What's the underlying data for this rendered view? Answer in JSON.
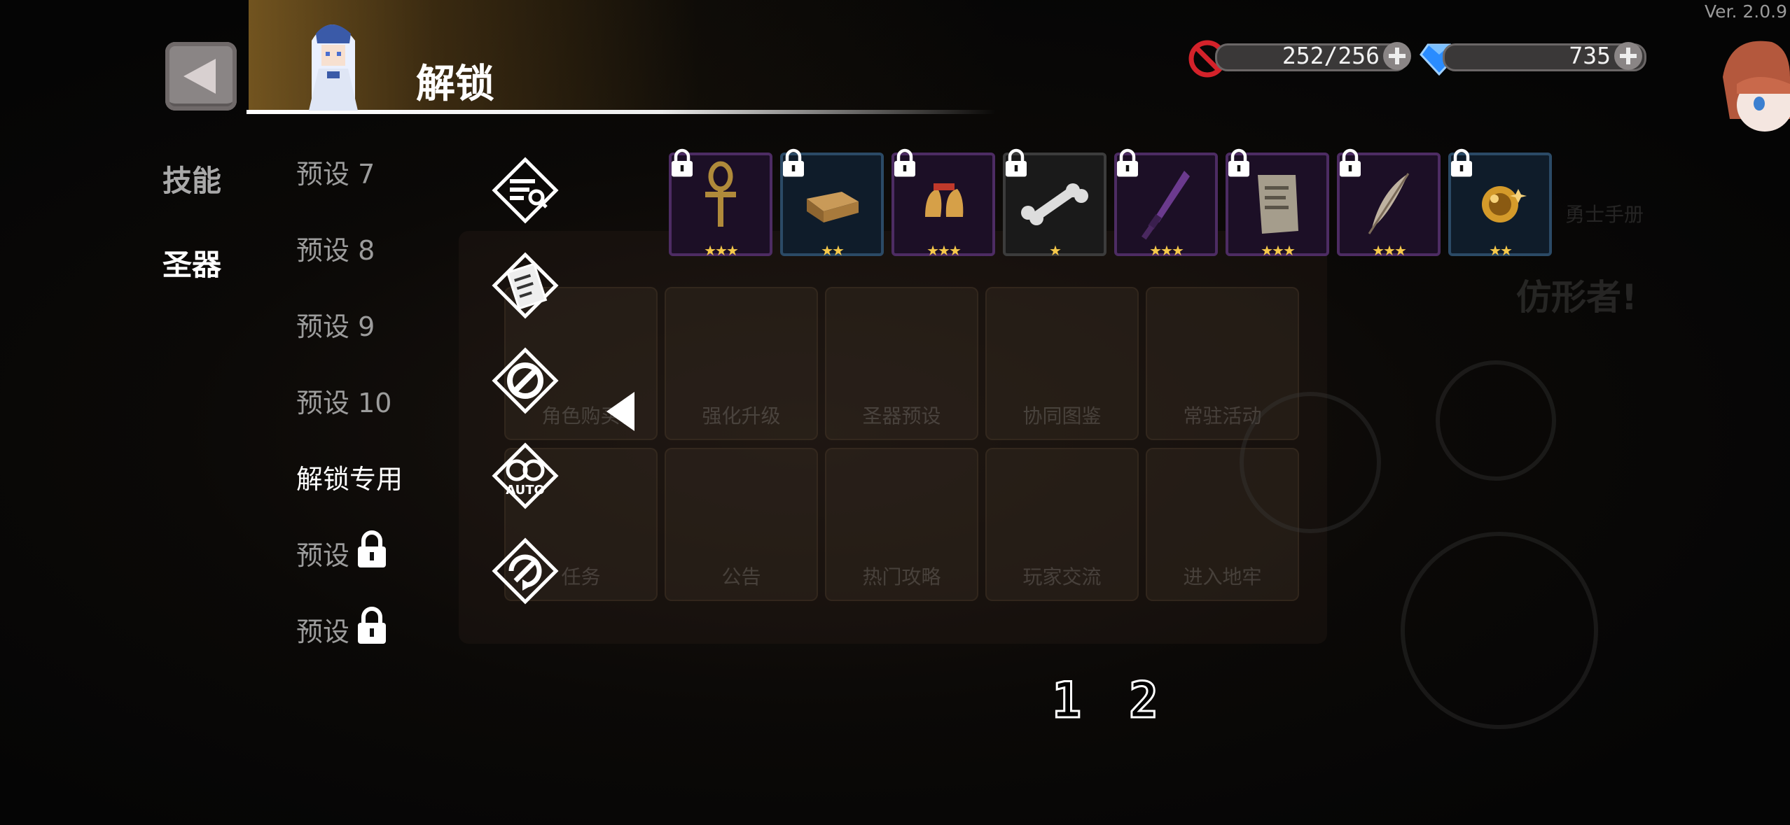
{
  "version": "Ver. 2.0.9",
  "header": {
    "title": "解锁"
  },
  "resources": {
    "stamina": "252/256",
    "gems": "735",
    "stamina_color": "#d4222a",
    "gem_color": "#2a8cff"
  },
  "categories": [
    {
      "label": "技能",
      "active": false
    },
    {
      "label": "圣器",
      "active": true
    }
  ],
  "presets": [
    {
      "label": "预设 7",
      "locked": false
    },
    {
      "label": "预设 8",
      "locked": false
    },
    {
      "label": "预设 9",
      "locked": false
    },
    {
      "label": "预设 10",
      "locked": false
    },
    {
      "label": "解锁专用",
      "locked": false,
      "active": true
    },
    {
      "label": "预设",
      "locked": true
    },
    {
      "label": "预设",
      "locked": true
    },
    {
      "label": "预设",
      "locked": true
    }
  ],
  "tools": [
    {
      "icon": "filter-search-icon"
    },
    {
      "icon": "scroll-list-icon"
    },
    {
      "icon": "no-entry-icon"
    },
    {
      "icon": "auto-icon",
      "label": "AUTO"
    },
    {
      "icon": "refresh-cancel-icon"
    }
  ],
  "artifacts": [
    {
      "item": "ankh",
      "rarity": 3,
      "stars": "★★★",
      "frame": "purple",
      "locked": true
    },
    {
      "item": "wooden-box",
      "rarity": 2,
      "stars": "★★",
      "frame": "blue",
      "locked": true
    },
    {
      "item": "bells",
      "rarity": 3,
      "stars": "★★★",
      "frame": "purple",
      "locked": true
    },
    {
      "item": "bone",
      "rarity": 1,
      "stars": "★",
      "frame": "grey",
      "locked": true
    },
    {
      "item": "purple-dagger",
      "rarity": 3,
      "stars": "★★★",
      "frame": "purple",
      "locked": true
    },
    {
      "item": "old-scroll",
      "rarity": 3,
      "stars": "★★★",
      "frame": "purple",
      "locked": true
    },
    {
      "item": "feather",
      "rarity": 3,
      "stars": "★★★",
      "frame": "purple",
      "locked": true
    },
    {
      "item": "golden-orb",
      "rarity": 2,
      "stars": "★★",
      "frame": "blue",
      "locked": true
    }
  ],
  "pagination": {
    "pages": [
      "1",
      "2"
    ]
  },
  "background_menu": {
    "row1": [
      "角色购买",
      "强化升级",
      "圣器预设",
      "协同图鉴",
      "常驻活动"
    ],
    "row2": [
      "任务",
      "公告",
      "热门攻略",
      "玩家交流",
      "进入地牢"
    ],
    "banner": "仿形者!",
    "corner": "勇士手册"
  }
}
